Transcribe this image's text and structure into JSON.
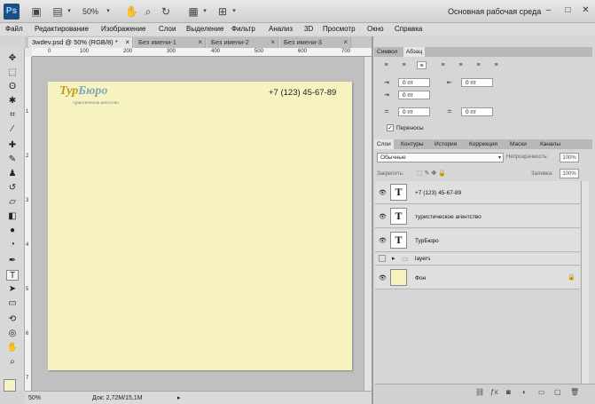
{
  "app": {
    "logo": "Ps",
    "zoom": "50%",
    "workspace": "Основная рабочая среда",
    "window_buttons": [
      "–",
      "□",
      "✕"
    ],
    "toolbar_icons": [
      "mini-bridge-icon",
      "screen-mode-icon",
      "hand-icon",
      "zoom-icon",
      "rotate-icon",
      "arrange-documents-icon",
      "screen-layout-icon"
    ]
  },
  "menu": [
    "Файл",
    "Редактирование",
    "Изображение",
    "Слои",
    "Выделение",
    "Фильтр",
    "Анализ",
    "3D",
    "Просмотр",
    "Окно",
    "Справка"
  ],
  "document_tabs": [
    {
      "label": "3wdev.psd @ 50% (RGB/8) *",
      "close": "×",
      "active": true
    },
    {
      "label": "Без имени-1",
      "close": "×",
      "active": false
    },
    {
      "label": "Без имени-2",
      "close": "×",
      "active": false
    },
    {
      "label": "Без имени-3",
      "close": "×",
      "active": false
    }
  ],
  "tools": [
    "move-tool",
    "marquee-tool",
    "lasso-tool",
    "magic-wand-tool",
    "crop-tool",
    "eyedropper-tool",
    "healing-brush-tool",
    "brush-tool",
    "clone-stamp-tool",
    "history-brush-tool",
    "eraser-tool",
    "gradient-tool",
    "blur-tool",
    "dodge-tool",
    "pen-tool",
    "type-tool",
    "path-selection-tool",
    "shape-tool",
    "3d-rotate-tool",
    "3d-orbit-tool",
    "hand-tool",
    "zoom-tool"
  ],
  "rulers": {
    "horizontal": [
      "0",
      "100",
      "200",
      "300",
      "400",
      "500",
      "600",
      "700"
    ],
    "vertical": [
      "1",
      "2",
      "3",
      "4",
      "5",
      "6",
      "7"
    ]
  },
  "canvas": {
    "logo_part1": "Тур",
    "logo_part2": "Бюро",
    "tagline": "туристическое агентство",
    "phone": "+7 (123) 45-67-89",
    "background_color": "#f7f3c1"
  },
  "status": {
    "zoom": "50%",
    "doc": "Док: 2,72M/15,1M",
    "arrow": "▸"
  },
  "paragraph_panel": {
    "tabs": [
      "Символ",
      "Абзац"
    ],
    "indent_left": "0 пт",
    "indent_right": "0 пт",
    "first_line": "0 пт",
    "space_before": "0 пт",
    "space_after": "0 пт",
    "hyphenate_label": "Переносы",
    "hyphenate_checked": true
  },
  "layers_panel": {
    "tabs": [
      "Слои",
      "Контуры",
      "История",
      "Коррекция",
      "Маски",
      "Каналы"
    ],
    "blend_mode": "Обычные",
    "opacity_label": "Непрозрачность:",
    "opacity": "100%",
    "lock_label": "Закрепить:",
    "fill_label": "Заливка:",
    "fill": "100%",
    "layers": [
      {
        "name": "+7 (123) 45-67-89",
        "kind": "text",
        "visible": true,
        "thumb": "T"
      },
      {
        "name": "туристическое агентство",
        "kind": "text",
        "visible": true,
        "thumb": "T"
      },
      {
        "name": "ТурБюро",
        "kind": "text",
        "visible": true,
        "thumb": "T"
      },
      {
        "name": "layers",
        "kind": "group",
        "visible": false
      },
      {
        "name": "Фон",
        "kind": "background",
        "visible": true,
        "locked": true
      }
    ]
  }
}
